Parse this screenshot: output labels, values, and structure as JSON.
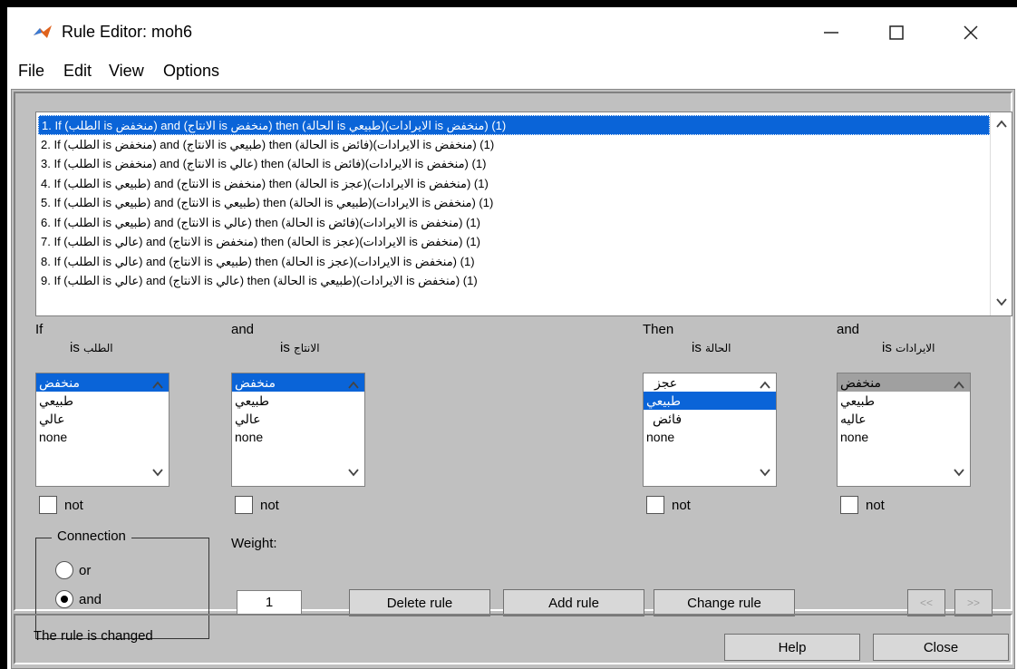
{
  "window": {
    "title": "Rule Editor: moh6"
  },
  "menu": [
    "File",
    "Edit",
    "View",
    "Options"
  ],
  "rules": [
    "1. If (الطلب is منخفض) and (الانتاج is منخفض) then (الحالة is طبيعي)(الايرادات is منخفض) (1)",
    "2. If (الطلب is منخفض) and (الانتاج is طبيعي) then (الحالة is فائض)(الايرادات is منخفض) (1)",
    "3. If (الطلب is منخفض) and (الانتاج is عالي) then (الحالة is فائض)(الايرادات is منخفض) (1)",
    "4. If (الطلب is طبيعي) and (الانتاج is منخفض) then (الحالة is عجز)(الايرادات is منخفض) (1)",
    "5. If (الطلب is طبيعي) and (الانتاج is طبيعي) then (الحالة is طبيعي)(الايرادات is منخفض) (1)",
    "6. If (الطلب is طبيعي) and (الانتاج is عالي) then (الحالة is فائض)(الايرادات is منخفض) (1)",
    "7. If (الطلب is عالي) and (الانتاج is منخفض) then (الحالة is عجز)(الايرادات is منخفض) (1)",
    "8. If (الطلب is عالي) and (الانتاج is طبيعي) then (الحالة is عجز)(الايرادات is منخفض) (1)",
    "9. If (الطلب is عالي) and (الانتاج is عالي) then (الحالة is طبيعي)(الايرادات is منخفض) (1)"
  ],
  "columns": [
    {
      "header": "If",
      "is": "is",
      "var": "الطلب",
      "items": [
        "منخفض",
        "طبيعي",
        "عالي",
        "none"
      ],
      "not": "not"
    },
    {
      "header": "and",
      "is": "is",
      "var": "الانتاج",
      "items": [
        "منخفض",
        "طبيعي",
        "عالي",
        "none"
      ],
      "not": "not"
    },
    {
      "header": "Then",
      "is": "is",
      "var": "الحالة",
      "items": [
        "عجز",
        "طبيعي",
        "فائض",
        "none"
      ],
      "not": "not"
    },
    {
      "header": "and",
      "is": "is",
      "var": "الايرادات",
      "items": [
        "منخفض",
        "طبيعي",
        "عاليه",
        "none"
      ],
      "not": "not"
    }
  ],
  "connection": {
    "title": "Connection",
    "or": "or",
    "and": "and",
    "selected": "and"
  },
  "weight": {
    "label": "Weight:",
    "value": "1"
  },
  "buttons": {
    "delete": "Delete rule",
    "add": "Add rule",
    "change": "Change rule",
    "prev": "<<",
    "next": ">>",
    "help": "Help",
    "close": "Close"
  },
  "status": "The rule is changed"
}
